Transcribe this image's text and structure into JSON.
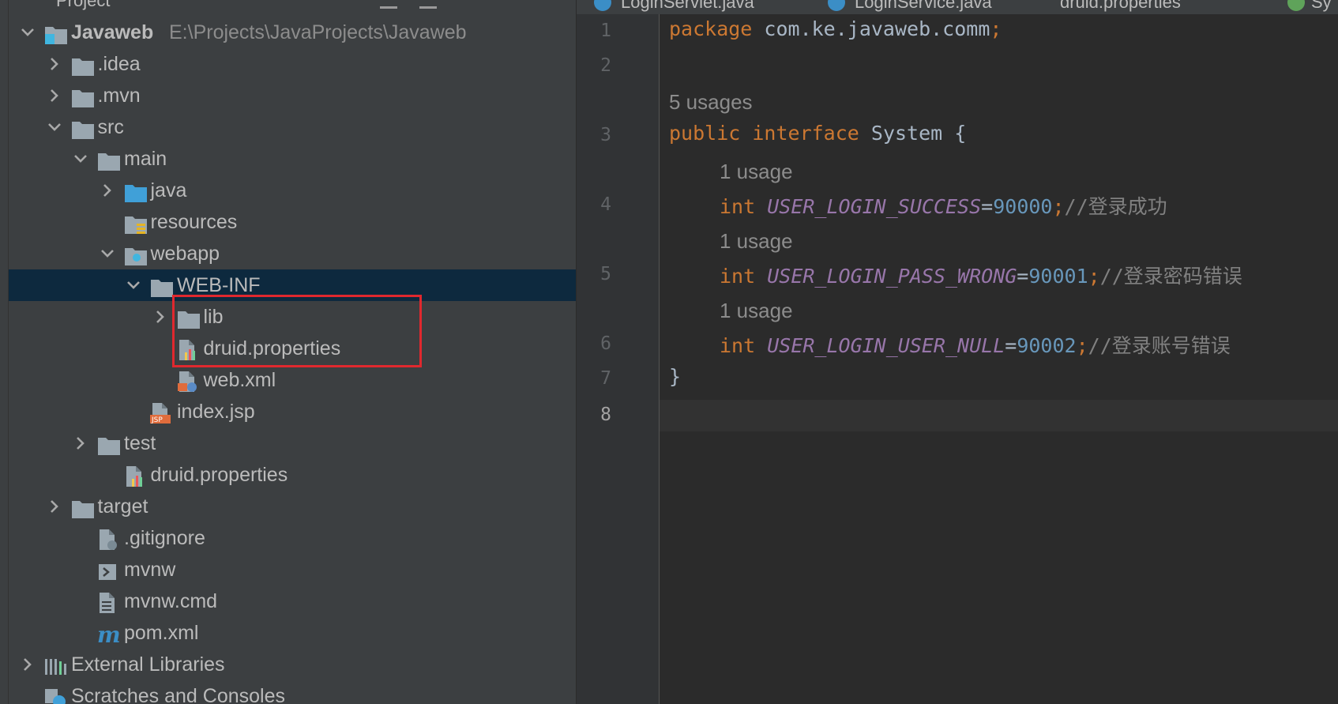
{
  "panel": {
    "title": "Project"
  },
  "tree": [
    {
      "id": "javaweb",
      "label": "Javaweb",
      "path": "E:\\Projects\\JavaProjects\\Javaweb",
      "indent": 0,
      "chev": "down",
      "icon": "module"
    },
    {
      "id": "idea",
      "label": ".idea",
      "indent": 1,
      "chev": "right",
      "icon": "folder"
    },
    {
      "id": "mvn",
      "label": ".mvn",
      "indent": 1,
      "chev": "right",
      "icon": "folder"
    },
    {
      "id": "src",
      "label": "src",
      "indent": 1,
      "chev": "down",
      "icon": "folder"
    },
    {
      "id": "main",
      "label": "main",
      "indent": 2,
      "chev": "down",
      "icon": "folder"
    },
    {
      "id": "java",
      "label": "java",
      "indent": 3,
      "chev": "right",
      "icon": "source-folder"
    },
    {
      "id": "resources",
      "label": "resources",
      "indent": 3,
      "chev": "none",
      "icon": "resources-folder"
    },
    {
      "id": "webapp",
      "label": "webapp",
      "indent": 3,
      "chev": "down",
      "icon": "web-folder"
    },
    {
      "id": "web-inf",
      "label": "WEB-INF",
      "indent": 4,
      "chev": "down",
      "icon": "folder",
      "selected": true
    },
    {
      "id": "lib",
      "label": "lib",
      "indent": 5,
      "chev": "right",
      "icon": "folder"
    },
    {
      "id": "druid-properties-webinf",
      "label": "druid.properties",
      "indent": 5,
      "chev": "none",
      "icon": "properties-file"
    },
    {
      "id": "web-xml",
      "label": "web.xml",
      "indent": 5,
      "chev": "none",
      "icon": "xml-file"
    },
    {
      "id": "index-jsp",
      "label": "index.jsp",
      "indent": 4,
      "chev": "none",
      "icon": "jsp-file"
    },
    {
      "id": "test",
      "label": "test",
      "indent": 2,
      "chev": "right",
      "icon": "folder"
    },
    {
      "id": "druid-properties-src",
      "label": "druid.properties",
      "indent": 3,
      "chev": "none",
      "icon": "properties-file"
    },
    {
      "id": "target",
      "label": "target",
      "indent": 1,
      "chev": "right",
      "icon": "folder"
    },
    {
      "id": "gitignore",
      "label": ".gitignore",
      "indent": 2,
      "chev": "none",
      "icon": "gitignore-file"
    },
    {
      "id": "mvnw",
      "label": "mvnw",
      "indent": 2,
      "chev": "none",
      "icon": "shell-file"
    },
    {
      "id": "mvnw-cmd",
      "label": "mvnw.cmd",
      "indent": 2,
      "chev": "none",
      "icon": "text-file"
    },
    {
      "id": "pom-xml",
      "label": "pom.xml",
      "indent": 2,
      "chev": "none",
      "icon": "maven-file"
    },
    {
      "id": "external-libraries",
      "label": "External Libraries",
      "indent": 0,
      "chev": "right",
      "icon": "libraries"
    },
    {
      "id": "scratches",
      "label": "Scratches and Consoles",
      "indent": 0,
      "chev": "none",
      "icon": "scratches"
    }
  ],
  "tabs": [
    {
      "label": "LoginServlet.java"
    },
    {
      "label": "LoginService.java"
    },
    {
      "label": "druid.properties"
    },
    {
      "label": "Sy"
    }
  ],
  "editor": {
    "line_numbers": [
      "1",
      "2",
      "3",
      "4",
      "5",
      "6",
      "7",
      "8"
    ],
    "code_line_1": {
      "kw": "package",
      "rest": " com.ke.javaweb.comm",
      "semi": ";"
    },
    "usages_class": "5 usages",
    "code_line_3": {
      "kw1": "public",
      "kw2": "interface",
      "rest": " System {"
    },
    "usage_1": "1 usage",
    "code_line_4": {
      "kw": "int",
      "field": "USER_LOGIN_SUCCESS",
      "eq": "=",
      "num": "90000",
      "semi": ";",
      "comment": "//登录成功"
    },
    "usage_2": "1 usage",
    "code_line_5": {
      "kw": "int",
      "field": "USER_LOGIN_PASS_WRONG",
      "eq": "=",
      "num": "90001",
      "semi": ";",
      "comment": "//登录密码错误"
    },
    "usage_3": "1 usage",
    "code_line_6": {
      "kw": "int",
      "field": "USER_LOGIN_USER_NULL",
      "eq": "=",
      "num": "90002",
      "semi": ";",
      "comment": "//登录账号错误"
    },
    "code_line_7": "}"
  },
  "colors": {
    "keyword": "#cc7832",
    "field": "#9876aa",
    "number": "#6897bb",
    "comment": "#808080",
    "highlight_box": "#e0282e",
    "selection": "#0d293e"
  }
}
